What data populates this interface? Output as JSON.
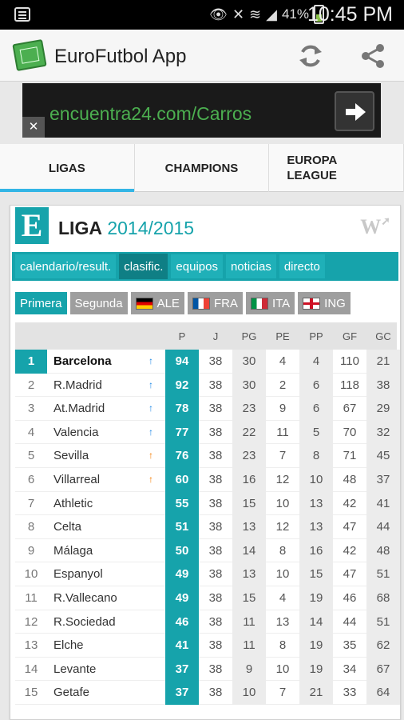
{
  "status_bar": {
    "battery": "41%",
    "time": "10:45 PM"
  },
  "app": {
    "title": "EuroFutbol App"
  },
  "ad": {
    "text": "encuentra24.com/Carros",
    "close": "✕"
  },
  "tabs": [
    {
      "label": "LIGAS"
    },
    {
      "label": "CHAMPIONS"
    },
    {
      "label": "EUROPA LEAGUE"
    }
  ],
  "card": {
    "logo_letter": "E",
    "title": "LIGA",
    "season": "2014/2015",
    "w_badge": "W"
  },
  "subnav": [
    "calendario/result.",
    "clasific.",
    "equipos",
    "noticias",
    "directo"
  ],
  "chips": [
    "Primera",
    "Segunda",
    "ALE",
    "FRA",
    "ITA",
    "ING"
  ],
  "columns": [
    "P",
    "J",
    "PG",
    "PE",
    "PP",
    "GF",
    "GC"
  ],
  "rows": [
    {
      "pos": "1",
      "team": "Barcelona",
      "trend": "up",
      "P": "94",
      "J": "38",
      "PG": "30",
      "PE": "4",
      "PP": "4",
      "GF": "110",
      "GC": "21"
    },
    {
      "pos": "2",
      "team": "R.Madrid",
      "trend": "up",
      "P": "92",
      "J": "38",
      "PG": "30",
      "PE": "2",
      "PP": "6",
      "GF": "118",
      "GC": "38"
    },
    {
      "pos": "3",
      "team": "At.Madrid",
      "trend": "up",
      "P": "78",
      "J": "38",
      "PG": "23",
      "PE": "9",
      "PP": "6",
      "GF": "67",
      "GC": "29"
    },
    {
      "pos": "4",
      "team": "Valencia",
      "trend": "up",
      "P": "77",
      "J": "38",
      "PG": "22",
      "PE": "11",
      "PP": "5",
      "GF": "70",
      "GC": "32"
    },
    {
      "pos": "5",
      "team": "Sevilla",
      "trend": "uo",
      "P": "76",
      "J": "38",
      "PG": "23",
      "PE": "7",
      "PP": "8",
      "GF": "71",
      "GC": "45"
    },
    {
      "pos": "6",
      "team": "Villarreal",
      "trend": "uo",
      "P": "60",
      "J": "38",
      "PG": "16",
      "PE": "12",
      "PP": "10",
      "GF": "48",
      "GC": "37"
    },
    {
      "pos": "7",
      "team": "Athletic",
      "trend": "",
      "P": "55",
      "J": "38",
      "PG": "15",
      "PE": "10",
      "PP": "13",
      "GF": "42",
      "GC": "41"
    },
    {
      "pos": "8",
      "team": "Celta",
      "trend": "",
      "P": "51",
      "J": "38",
      "PG": "13",
      "PE": "12",
      "PP": "13",
      "GF": "47",
      "GC": "44"
    },
    {
      "pos": "9",
      "team": "Málaga",
      "trend": "",
      "P": "50",
      "J": "38",
      "PG": "14",
      "PE": "8",
      "PP": "16",
      "GF": "42",
      "GC": "48"
    },
    {
      "pos": "10",
      "team": "Espanyol",
      "trend": "",
      "P": "49",
      "J": "38",
      "PG": "13",
      "PE": "10",
      "PP": "15",
      "GF": "47",
      "GC": "51"
    },
    {
      "pos": "11",
      "team": "R.Vallecano",
      "trend": "",
      "P": "49",
      "J": "38",
      "PG": "15",
      "PE": "4",
      "PP": "19",
      "GF": "46",
      "GC": "68"
    },
    {
      "pos": "12",
      "team": "R.Sociedad",
      "trend": "",
      "P": "46",
      "J": "38",
      "PG": "11",
      "PE": "13",
      "PP": "14",
      "GF": "44",
      "GC": "51"
    },
    {
      "pos": "13",
      "team": "Elche",
      "trend": "",
      "P": "41",
      "J": "38",
      "PG": "11",
      "PE": "8",
      "PP": "19",
      "GF": "35",
      "GC": "62"
    },
    {
      "pos": "14",
      "team": "Levante",
      "trend": "",
      "P": "37",
      "J": "38",
      "PG": "9",
      "PE": "10",
      "PP": "19",
      "GF": "34",
      "GC": "67"
    },
    {
      "pos": "15",
      "team": "Getafe",
      "trend": "",
      "P": "37",
      "J": "38",
      "PG": "10",
      "PE": "7",
      "PP": "21",
      "GF": "33",
      "GC": "64"
    }
  ],
  "colors": {
    "accent": "#16a3ab",
    "tab_indicator": "#33b5e5",
    "trend_up": "#1e88e5",
    "trend_europa": "#f57c00"
  }
}
